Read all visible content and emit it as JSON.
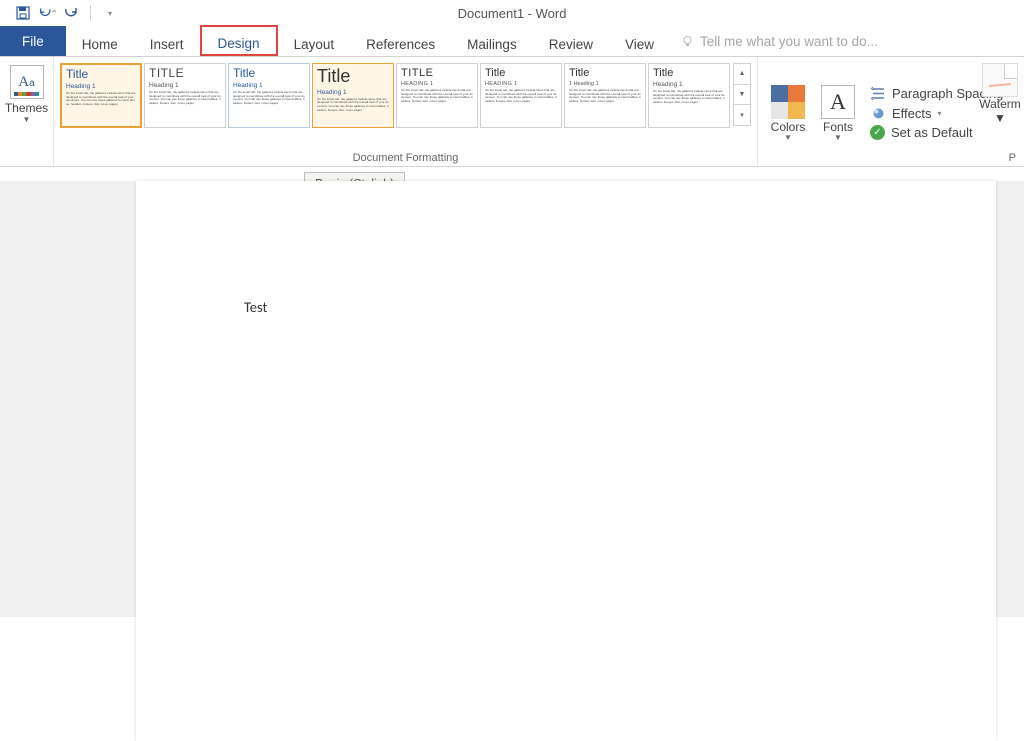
{
  "title": "Document1 - Word",
  "qat": {
    "save": "save-icon",
    "undo": "undo-icon",
    "redo": "redo-icon"
  },
  "tabs": {
    "file": "File",
    "home": "Home",
    "insert": "Insert",
    "design": "Design",
    "layout": "Layout",
    "references": "References",
    "mailings": "Mailings",
    "review": "Review",
    "view": "View",
    "tellme": "Tell me what you want to do..."
  },
  "themes_label": "Themes",
  "formatting_label": "Document Formatting",
  "pagebg_label": "P",
  "colors_label": "Colors",
  "fonts_label": "Fonts",
  "paragraph_spacing": "Paragraph Spacing",
  "effects": "Effects",
  "set_default": "Set as Default",
  "watermark": "Waterm",
  "tooltip": "Basic (Stylish)",
  "body_text": "Test",
  "gallery": [
    {
      "title": "Title",
      "heading": "Heading 1",
      "titleStyle": "color:#2b579a;font-size:12px;",
      "headStyle": "color:#2b579a;font-size:6.5px;",
      "selected": true
    },
    {
      "title": "TITLE",
      "heading": "Heading 1",
      "titleStyle": "color:#444;letter-spacing:0.5px;font-size:12px;",
      "headStyle": "color:#555;font-size:6.5px;"
    },
    {
      "title": "Title",
      "heading": "Heading 1",
      "titleStyle": "color:#2b579a;font-size:12px;",
      "headStyle": "color:#2b579a;font-size:6.5px;",
      "outlined": true
    },
    {
      "title": "Title",
      "heading": "Heading 1",
      "titleStyle": "color:#333;font-size:18px;font-weight:300;",
      "headStyle": "color:#2b579a;font-size:6.5px;",
      "hovered": true
    },
    {
      "title": "TITLE",
      "heading": "HEADING 1",
      "titleStyle": "color:#333;font-size:11px;letter-spacing:0.5px;",
      "headStyle": "color:#555;font-size:5.5px;letter-spacing:0.3px;"
    },
    {
      "title": "Title",
      "heading": "HEADING 1",
      "titleStyle": "color:#333;font-size:11px;",
      "headStyle": "color:#555;font-size:5.5px;letter-spacing:0.3px;"
    },
    {
      "title": "Title",
      "heading": "1  Heading 1",
      "titleStyle": "color:#333;font-size:11px;",
      "headStyle": "color:#555;font-size:5.5px;"
    },
    {
      "title": "Title",
      "heading": "Heading 1",
      "titleStyle": "color:#333;font-size:11px;",
      "headStyle": "color:#555;font-size:6.5px;"
    }
  ],
  "lorem": "On the Insert tab, the galleries include items that are designed to coordinate with the overall look of your document. You can use these galleries to insert tables, headers, footers, lists, cover pages,"
}
